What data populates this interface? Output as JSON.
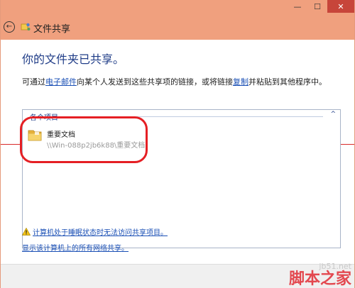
{
  "window": {
    "title": "文件共享",
    "controls": {
      "minimize": "—",
      "maximize": "☐",
      "close": "✕"
    }
  },
  "main": {
    "heading": "你的文件夹已共享。",
    "description": {
      "part1": "可通过",
      "email_link": "电子邮件",
      "part2": "向某个人发送到这些共享项的链接，或将链接",
      "copy_link": "复制",
      "part3": "并粘贴到其他程序中。"
    },
    "list": {
      "group_label": "各个项目",
      "collapse_glyph": "^",
      "items": [
        {
          "name": "重要文档",
          "path": "\\\\Win-088p2jb6k88\\重要文档"
        }
      ]
    },
    "warning_link": "计算机处于睡眠状态时无法访问共享项目。",
    "show_shares_link": "显示该计算机上的所有网络共享。"
  },
  "watermark": {
    "small": "jb51.net",
    "big": "脚本之家"
  }
}
